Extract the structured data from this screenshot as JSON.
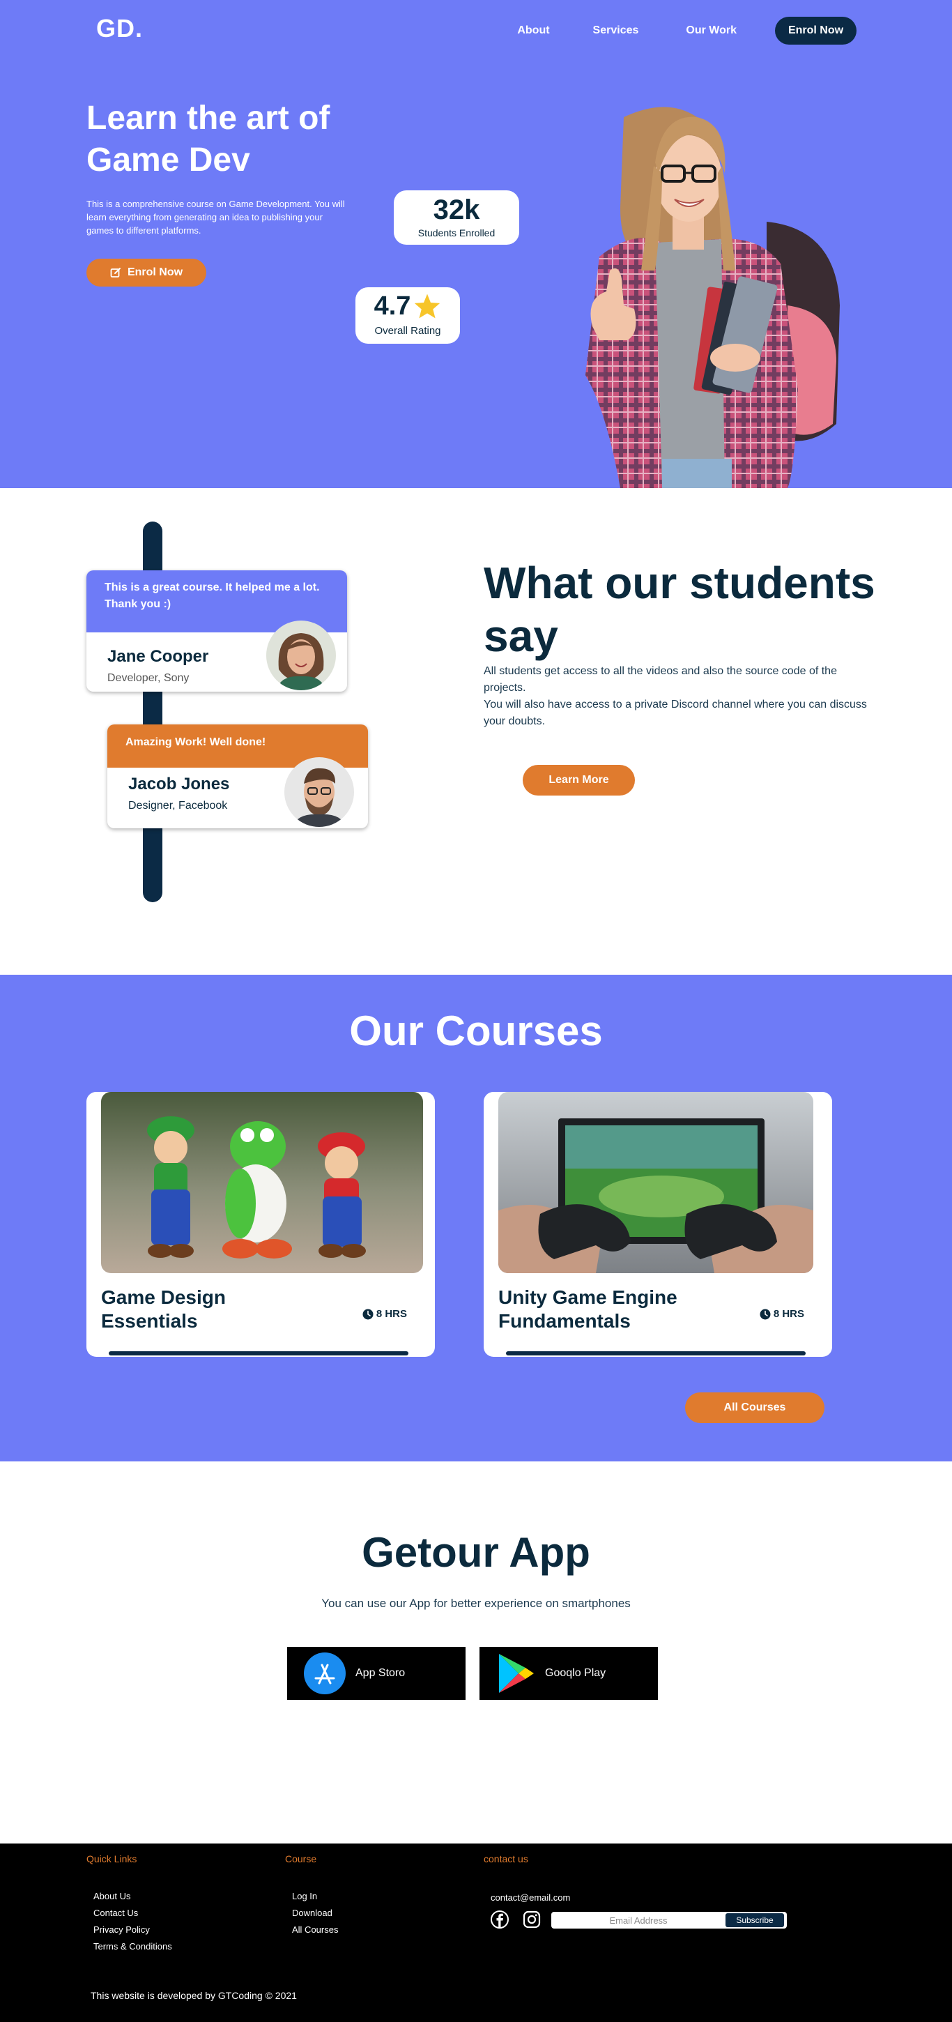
{
  "colors": {
    "primary": "#6e7bf7",
    "accent": "#e07b2e",
    "dark": "#0b2a45",
    "white": "#ffffff"
  },
  "header": {
    "logo": "GD.",
    "nav": {
      "about": "About",
      "services": "Services",
      "work": "Our Work",
      "enrol": "Enrol Now"
    }
  },
  "hero": {
    "title": "Learn the art of Game Dev",
    "description": "This is a comprehensive course on Game Development. You will learn everything from generating an idea to publishing your games to different platforms.",
    "enrol_button": "Enrol Now",
    "enrol_icon": "edit-icon",
    "stats": [
      {
        "value": "32k",
        "label": "Students Enrolled"
      },
      {
        "value": "4.7",
        "label": "Overall Rating",
        "icon": "star-icon"
      }
    ]
  },
  "testimonials": {
    "title": "What our students say",
    "text_1": "All students get access to all the videos and also the source code of the projects.",
    "text_2": "You will also have access to a private Discord channel where you can discuss your doubts.",
    "learn_button": "Learn More",
    "cards": [
      {
        "quote": "This is a great course. It helped me a lot. Thank you :)",
        "name": "Jane Cooper",
        "role": "Developer, Sony"
      },
      {
        "quote": "Amazing Work! Well done!",
        "name": "Jacob Jones",
        "role": "Designer, Facebook"
      }
    ]
  },
  "courses": {
    "title": "Our Courses",
    "items": [
      {
        "title": "Game Design Essentials",
        "duration": "8 HRS"
      },
      {
        "title": "Unity Game Engine Fundamentals",
        "duration": "8 HRS"
      }
    ],
    "all_button": "All Courses"
  },
  "app": {
    "title": "Getour App",
    "subtitle": "You can use our App for better experience on smartphones",
    "stores": [
      {
        "label": "App Storo",
        "icon": "app-store-icon"
      },
      {
        "label": "Gooqlo Play",
        "icon": "google-play-icon"
      }
    ]
  },
  "footer": {
    "quick_links": {
      "heading": "Quick Links",
      "items": [
        "About Us",
        "Contact Us",
        "Privacy Policy",
        "Terms & Conditions"
      ]
    },
    "course": {
      "heading": "Course",
      "items": [
        "Log In",
        "Download",
        "All Courses"
      ]
    },
    "contact": {
      "heading": "contact us",
      "email": "contact@email.com",
      "email_placeholder": "Email Address",
      "subscribe": "Subscribe"
    },
    "copyright": "This website is developed by GTCoding © 2021"
  }
}
